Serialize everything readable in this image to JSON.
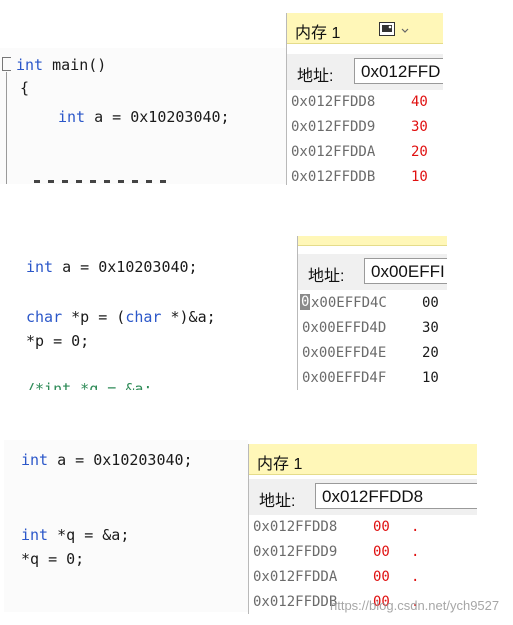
{
  "panel1": {
    "code": {
      "line1": "int main()",
      "line2": "{",
      "line3": "int a = 0x10203040;"
    },
    "memory": {
      "title": "内存 1",
      "address_label": "地址:",
      "address_value": "0x012FFD",
      "rows": [
        {
          "addr": "0x012FFDD8",
          "value": "40"
        },
        {
          "addr": "0x012FFDD9",
          "value": "30"
        },
        {
          "addr": "0x012FFDDA",
          "value": "20"
        },
        {
          "addr": "0x012FFDDB",
          "value": "10"
        }
      ]
    }
  },
  "panel2": {
    "code": {
      "line1": "int a = 0x10203040;",
      "line2": "char *p = (char *)&a;",
      "line3": "*p = 0;",
      "line4": "/*int *q = &a;"
    },
    "memory": {
      "address_label": "地址:",
      "address_value": "0x00EFFI",
      "cursor_char": "0",
      "rows": [
        {
          "addr": "x00EFFD4C",
          "value": "00"
        },
        {
          "addr": "0x00EFFD4D",
          "value": "30"
        },
        {
          "addr": "0x00EFFD4E",
          "value": "20"
        },
        {
          "addr": "0x00EFFD4F",
          "value": "10"
        }
      ]
    }
  },
  "panel3": {
    "code": {
      "line1": "int a = 0x10203040;",
      "line2": "int *q = &a;",
      "line3": "*q = 0;"
    },
    "memory": {
      "title": "内存 1",
      "address_label": "地址:",
      "address_value": "0x012FFDD8",
      "rows": [
        {
          "addr": "0x012FFDD8",
          "value": "00",
          "char": "."
        },
        {
          "addr": "0x012FFDD9",
          "value": "00",
          "char": "."
        },
        {
          "addr": "0x012FFDDA",
          "value": "00",
          "char": "."
        },
        {
          "addr": "0x012FFDDB",
          "value": "00",
          "char": "."
        }
      ]
    }
  },
  "watermark": "https://blog.csdn.net/ych9527",
  "icons": {
    "collapse": "collapse-minus-icon",
    "picture": "picture-icon",
    "dropdown": "chevron-down-icon"
  }
}
